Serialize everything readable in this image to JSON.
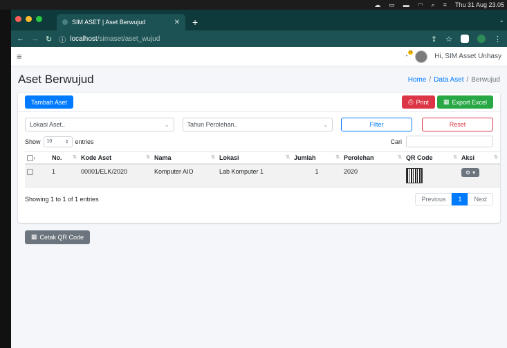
{
  "system_menubar": {
    "datetime": "Thu 31 Aug 23.05"
  },
  "browser": {
    "tab_title": "SIM ASET | Aset Berwujud",
    "new_tab": "+",
    "url_host": "localhost",
    "url_path": "/simaset/aset_wujud"
  },
  "navbar": {
    "notification_count": "0",
    "user_greeting": "Hi, SIM Asset Unhasy"
  },
  "header": {
    "title": "Aset Berwujud",
    "breadcrumb": [
      "Home",
      "Data Aset",
      "Berwujud"
    ]
  },
  "toolbar": {
    "add_label": "Tambah Aset",
    "print_label": "Print",
    "export_label": "Export Excel"
  },
  "filters": {
    "location_placeholder": "Lokasi Aset..",
    "year_placeholder": "Tahun Perolehan..",
    "filter_label": "Filter",
    "reset_label": "Reset"
  },
  "table_controls": {
    "show_label": "Show",
    "length_value": "10",
    "entries_label": "entries",
    "search_label": "Cari"
  },
  "table": {
    "headers": [
      "No.",
      "Kode Aset",
      "Nama",
      "Lokasi",
      "Jumlah",
      "Perolehan",
      "QR Code",
      "Aksi"
    ],
    "rows": [
      {
        "no": "1",
        "kode": "00001/ELK/2020",
        "nama": "Komputer AIO",
        "lokasi": "Lab Komputer 1",
        "jumlah": "1",
        "perolehan": "2020"
      }
    ]
  },
  "footer": {
    "info": "Showing 1 to 1 of 1 entries",
    "prev_label": "Previous",
    "page_label": "1",
    "next_label": "Next"
  },
  "qr_button_label": "Cetak QR Code",
  "colors": {
    "primary": "#007bff",
    "danger": "#dc3545",
    "success": "#28a745",
    "secondary": "#6c757d",
    "browser_chrome": "#1d5254"
  }
}
